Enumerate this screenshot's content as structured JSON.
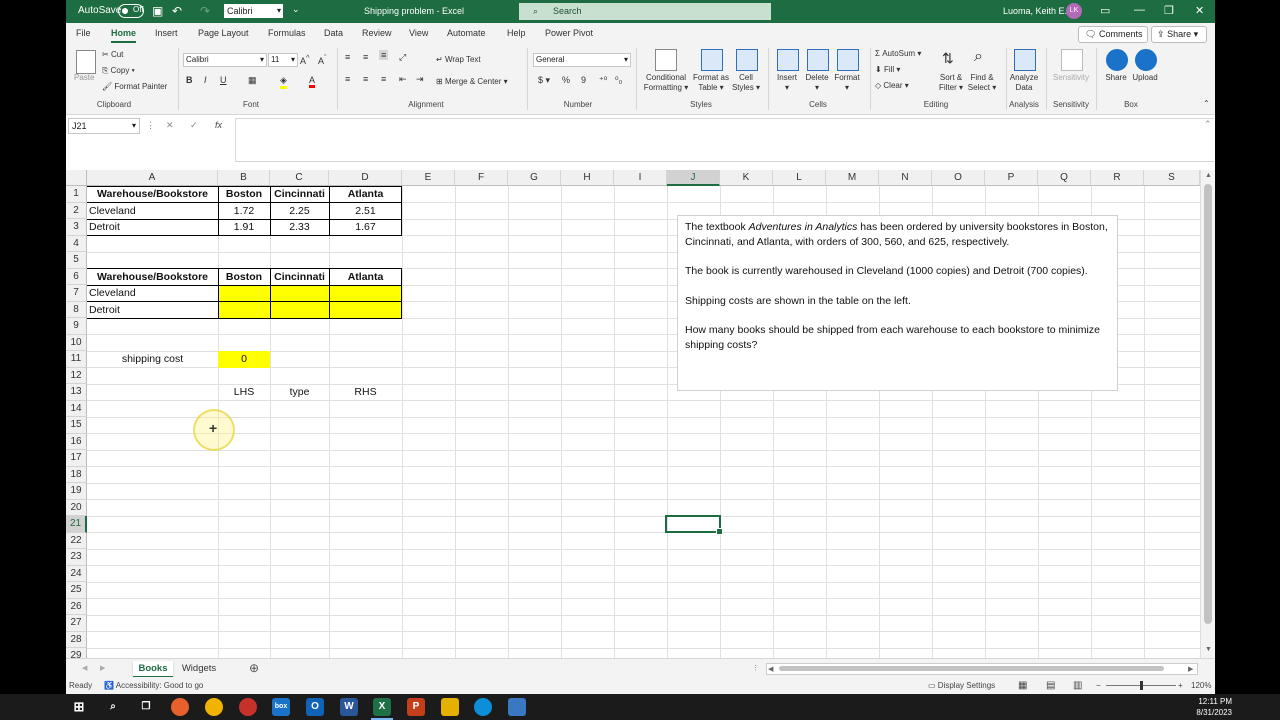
{
  "titlebar": {
    "autosave_label": "AutoSave",
    "autosave_state": "Off",
    "font_name": "Calibri",
    "doc_title": "Shipping problem  -  Excel",
    "search_placeholder": "Search",
    "user_name": "Luoma, Keith E.",
    "user_initials": "LK"
  },
  "menu": {
    "tabs": [
      "File",
      "Home",
      "Insert",
      "Page Layout",
      "Formulas",
      "Data",
      "Review",
      "View",
      "Automate",
      "Help",
      "Power Pivot"
    ],
    "active_tab": "Home",
    "comments": "Comments",
    "share": "Share"
  },
  "ribbon": {
    "clipboard": {
      "paste": "Paste",
      "cut": "Cut",
      "copy": "Copy",
      "format_painter": "Format Painter",
      "label": "Clipboard"
    },
    "font": {
      "name": "Calibri",
      "size": "11",
      "bold": "B",
      "italic": "I",
      "underline": "U",
      "label": "Font"
    },
    "alignment": {
      "wrap": "Wrap Text",
      "merge": "Merge & Center",
      "label": "Alignment"
    },
    "number": {
      "format": "General",
      "currency": "$",
      "percent": "%",
      "comma": "9",
      "label": "Number"
    },
    "styles": {
      "conditional": "Conditional",
      "conditional2": "Formatting",
      "format_table": "Format as",
      "format_table2": "Table",
      "cell_styles": "Cell",
      "cell_styles2": "Styles",
      "label": "Styles"
    },
    "cells": {
      "insert": "Insert",
      "delete": "Delete",
      "format": "Format",
      "label": "Cells"
    },
    "editing": {
      "autosum": "AutoSum",
      "fill": "Fill",
      "clear": "Clear",
      "sort": "Sort &",
      "sort2": "Filter",
      "find": "Find &",
      "find2": "Select",
      "label": "Editing"
    },
    "analysis": {
      "analyze": "Analyze",
      "analyze2": "Data",
      "label": "Analysis"
    },
    "sensitivity": {
      "sensitivity": "Sensitivity",
      "label": "Sensitivity"
    },
    "box": {
      "share": "Share",
      "upload": "Upload",
      "label": "Box"
    }
  },
  "formula_bar": {
    "name_box": "J21",
    "fx": "fx",
    "formula": ""
  },
  "columns": [
    "A",
    "B",
    "C",
    "D",
    "E",
    "F",
    "G",
    "H",
    "I",
    "J",
    "K",
    "L",
    "M",
    "N",
    "O",
    "P",
    "Q",
    "R",
    "S"
  ],
  "selected_column": "J",
  "selected_row": "21",
  "rows": [
    "1",
    "2",
    "3",
    "4",
    "5",
    "6",
    "7",
    "8",
    "9",
    "10",
    "11",
    "12",
    "13",
    "14",
    "15",
    "16",
    "17",
    "18",
    "19",
    "20",
    "21",
    "22",
    "23",
    "24",
    "25",
    "26",
    "27",
    "28",
    "29"
  ],
  "cells": {
    "A1": "Warehouse/Bookstore",
    "B1": "Boston",
    "C1": "Cincinnati",
    "D1": "Atlanta",
    "A2": "Cleveland",
    "B2": "1.72",
    "C2": "2.25",
    "D2": "2.51",
    "A3": "Detroit",
    "B3": "1.91",
    "C3": "2.33",
    "D3": "1.67",
    "A6": "Warehouse/Bookstore",
    "B6": "Boston",
    "C6": "Cincinnati",
    "D6": "Atlanta",
    "A7": "Cleveland",
    "A8": "Detroit",
    "A11": "shipping cost",
    "B11": "0",
    "B13": "LHS",
    "C13": "type",
    "D13": "RHS"
  },
  "textbox": {
    "p1_pre": "The textbook ",
    "p1_italic": "Adventures in Analytics",
    "p1_post": " has been ordered by university bookstores in Boston, Cincinnati, and Atlanta, with orders of 300, 560, and 625, respectively.",
    "p2": "The book is currently warehoused in Cleveland (1000 copies) and Detroit (700 copies).",
    "p3": "Shipping costs are shown in the table on the left.",
    "p4": "How many books should be shipped from each warehouse to each bookstore to minimize shipping costs?"
  },
  "sheets": [
    "Books",
    "Widgets"
  ],
  "active_sheet": "Books",
  "status": {
    "ready": "Ready",
    "accessibility": "Accessibility: Good to go",
    "display_settings": "Display Settings",
    "zoom": "120%"
  },
  "taskbar": {
    "time": "12:11 PM",
    "date": "8/31/2023"
  },
  "colors": {
    "excel_green": "#1e6c41",
    "input_yellow": "#ffff00"
  }
}
